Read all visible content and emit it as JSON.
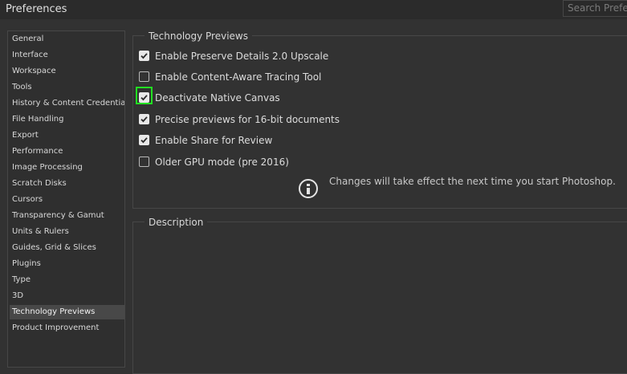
{
  "window": {
    "title": "Preferences"
  },
  "search": {
    "placeholder": "Search Preferences"
  },
  "sidebar": {
    "items": [
      {
        "label": "General",
        "selected": false
      },
      {
        "label": "Interface",
        "selected": false
      },
      {
        "label": "Workspace",
        "selected": false
      },
      {
        "label": "Tools",
        "selected": false
      },
      {
        "label": "History & Content Credentials",
        "selected": false
      },
      {
        "label": "File Handling",
        "selected": false
      },
      {
        "label": "Export",
        "selected": false
      },
      {
        "label": "Performance",
        "selected": false
      },
      {
        "label": "Image Processing",
        "selected": false
      },
      {
        "label": "Scratch Disks",
        "selected": false
      },
      {
        "label": "Cursors",
        "selected": false
      },
      {
        "label": "Transparency & Gamut",
        "selected": false
      },
      {
        "label": "Units & Rulers",
        "selected": false
      },
      {
        "label": "Guides, Grid & Slices",
        "selected": false
      },
      {
        "label": "Plugins",
        "selected": false
      },
      {
        "label": "Type",
        "selected": false
      },
      {
        "label": "3D",
        "selected": false
      },
      {
        "label": "Technology Previews",
        "selected": true
      },
      {
        "label": "Product Improvement",
        "selected": false
      }
    ]
  },
  "tech_previews": {
    "heading": "Technology Previews",
    "options": [
      {
        "label": "Enable Preserve Details 2.0 Upscale",
        "checked": true
      },
      {
        "label": "Enable Content-Aware Tracing Tool",
        "checked": false
      },
      {
        "label": "Deactivate Native Canvas",
        "checked": true,
        "highlighted": true
      },
      {
        "label": "Precise previews for 16-bit documents",
        "checked": true
      },
      {
        "label": "Enable Share for Review",
        "checked": true
      },
      {
        "label": "Older GPU mode (pre 2016)",
        "checked": false
      }
    ],
    "info_icon": "info-circle-icon",
    "notice": "Changes will take effect the next time you start Photoshop."
  },
  "description": {
    "heading": "Description"
  },
  "colors": {
    "background": "#323232",
    "title_bar": "#2b2b2b",
    "selected_item": "#484848",
    "highlight_outline": "#22e022",
    "checkbox_checked": "#e8e8e8"
  }
}
